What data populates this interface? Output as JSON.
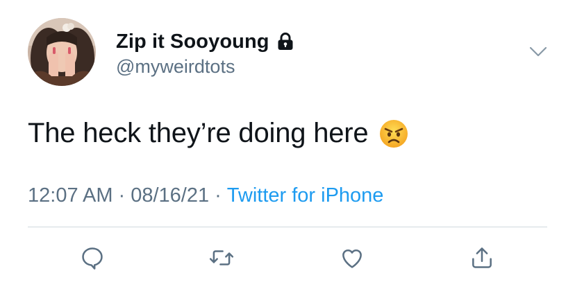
{
  "author": {
    "display_name": "Zip it Sooyoung",
    "handle": "@myweirdtots",
    "protected_icon": "lock-icon",
    "avatar": "profile-photo"
  },
  "tweet": {
    "text": "The heck they’re doing here",
    "emoji": "angry-face-emoji"
  },
  "meta": {
    "time": "12:07 AM",
    "separator": "·",
    "date": "08/16/21",
    "source": "Twitter for iPhone"
  },
  "actions": [
    {
      "icon": "reply-icon"
    },
    {
      "icon": "retweet-icon"
    },
    {
      "icon": "like-icon"
    },
    {
      "icon": "share-icon"
    }
  ],
  "colors": {
    "text_primary": "#0f1419",
    "text_secondary": "#5b7083",
    "link": "#1d9bf0",
    "icon": "#5b7083",
    "divider": "#cfd9de"
  }
}
